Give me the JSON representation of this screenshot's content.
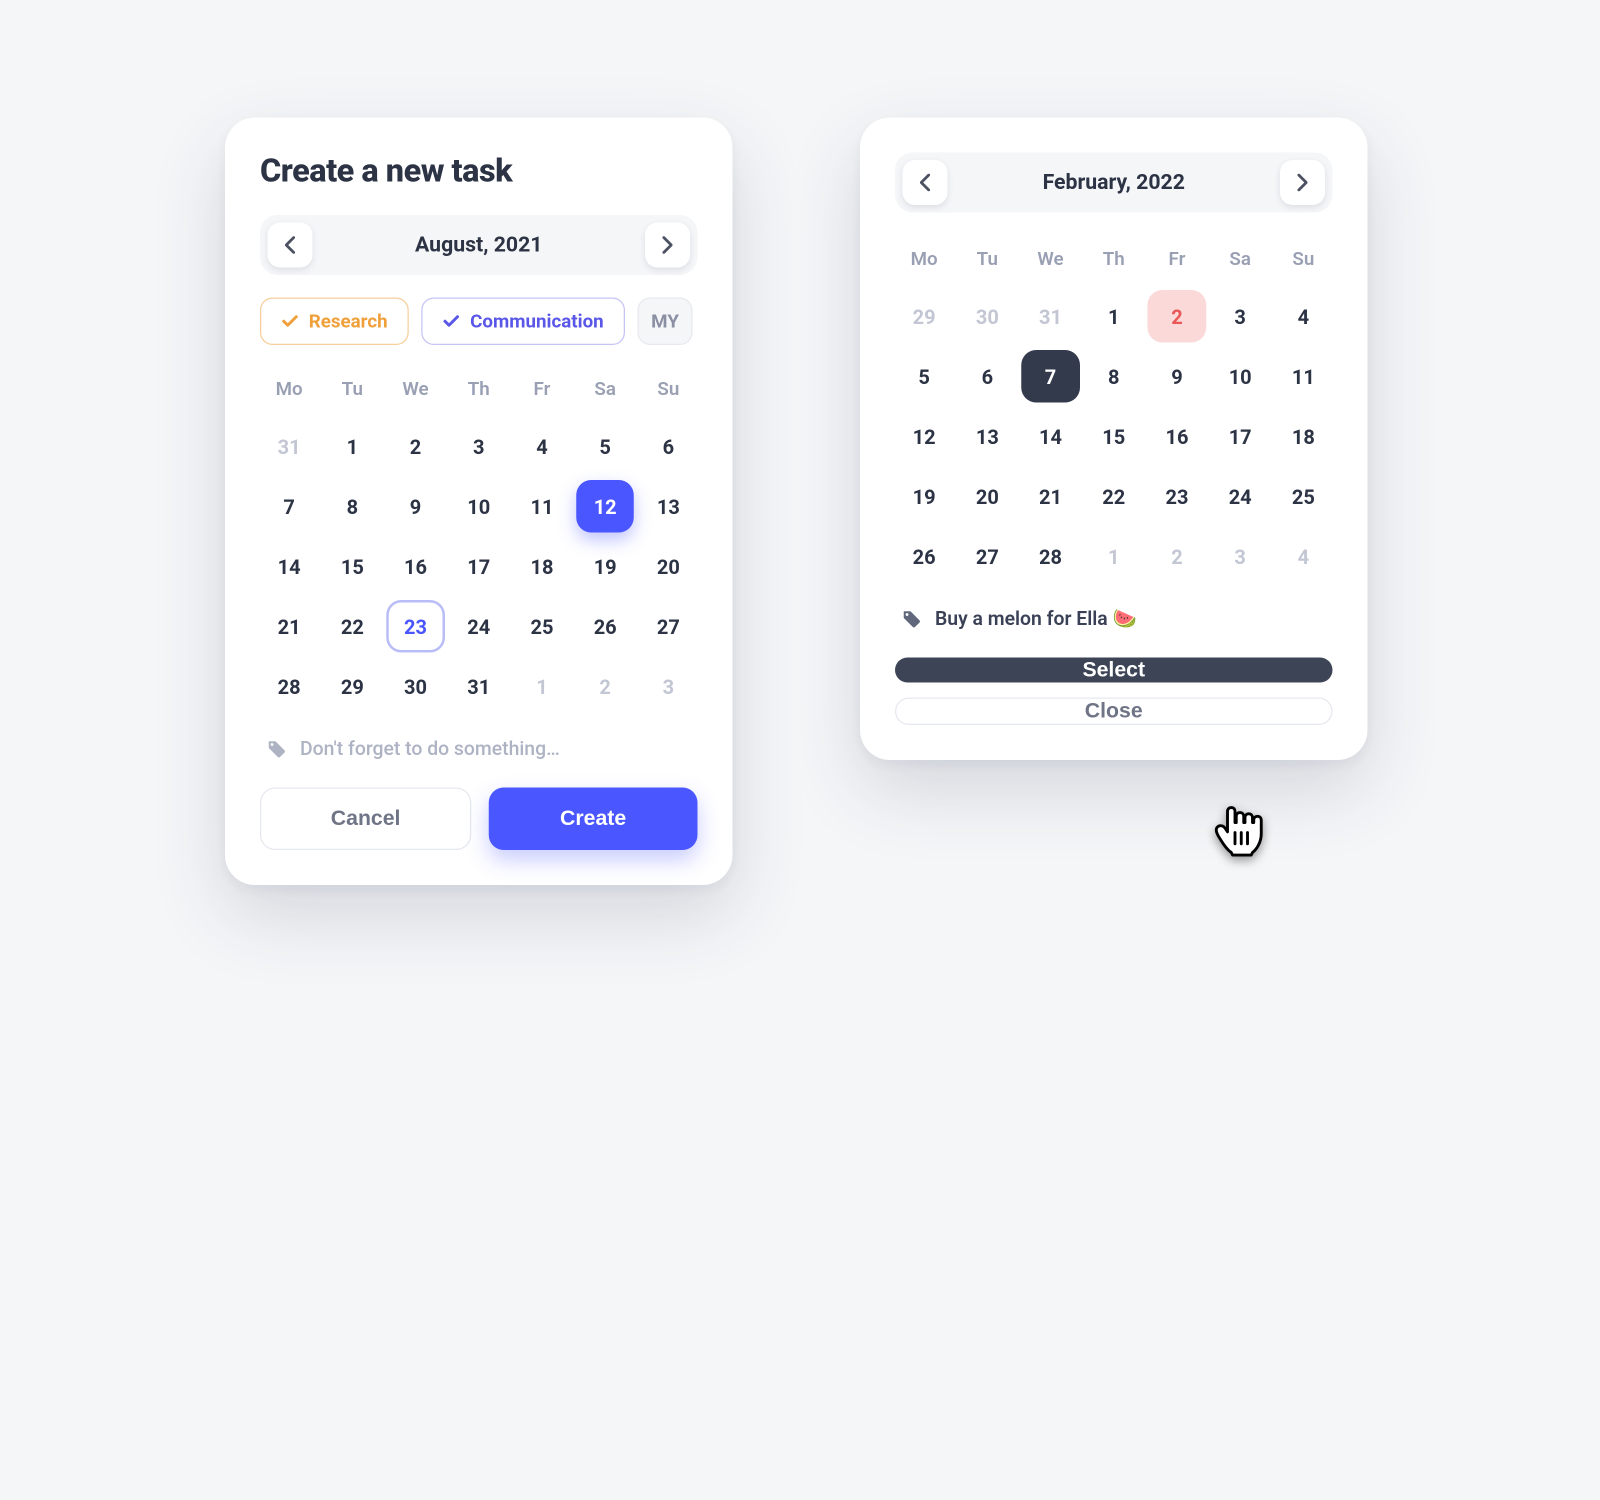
{
  "left": {
    "title": "Create a new task",
    "month": "August, 2021",
    "tags": {
      "research": "Research",
      "communication": "Communication",
      "partial": "MY"
    },
    "dow": [
      "Mo",
      "Tu",
      "We",
      "Th",
      "Fr",
      "Sa",
      "Su"
    ],
    "weeks": [
      [
        {
          "d": "31",
          "muted": true
        },
        {
          "d": "1"
        },
        {
          "d": "2"
        },
        {
          "d": "3"
        },
        {
          "d": "4"
        },
        {
          "d": "5"
        },
        {
          "d": "6"
        }
      ],
      [
        {
          "d": "7"
        },
        {
          "d": "8"
        },
        {
          "d": "9"
        },
        {
          "d": "10"
        },
        {
          "d": "11"
        },
        {
          "d": "12",
          "style": "sel-blue"
        },
        {
          "d": "13"
        }
      ],
      [
        {
          "d": "14"
        },
        {
          "d": "15"
        },
        {
          "d": "16"
        },
        {
          "d": "17"
        },
        {
          "d": "18"
        },
        {
          "d": "19"
        },
        {
          "d": "20"
        }
      ],
      [
        {
          "d": "21"
        },
        {
          "d": "22"
        },
        {
          "d": "23",
          "style": "outline-blue"
        },
        {
          "d": "24"
        },
        {
          "d": "25"
        },
        {
          "d": "26"
        },
        {
          "d": "27"
        }
      ],
      [
        {
          "d": "28"
        },
        {
          "d": "29"
        },
        {
          "d": "30"
        },
        {
          "d": "31"
        },
        {
          "d": "1",
          "muted": true
        },
        {
          "d": "2",
          "muted": true
        },
        {
          "d": "3",
          "muted": true
        }
      ]
    ],
    "note_placeholder": "Don't forget to do something…",
    "cancel": "Cancel",
    "create": "Create"
  },
  "right": {
    "month": "February, 2022",
    "dow": [
      "Mo",
      "Tu",
      "We",
      "Th",
      "Fr",
      "Sa",
      "Su"
    ],
    "weeks": [
      [
        {
          "d": "29",
          "muted": true
        },
        {
          "d": "30",
          "muted": true
        },
        {
          "d": "31",
          "muted": true
        },
        {
          "d": "1"
        },
        {
          "d": "2",
          "style": "highlight-red"
        },
        {
          "d": "3"
        },
        {
          "d": "4"
        }
      ],
      [
        {
          "d": "5"
        },
        {
          "d": "6"
        },
        {
          "d": "7",
          "style": "sel-dark"
        },
        {
          "d": "8"
        },
        {
          "d": "9"
        },
        {
          "d": "10"
        },
        {
          "d": "11"
        }
      ],
      [
        {
          "d": "12"
        },
        {
          "d": "13"
        },
        {
          "d": "14"
        },
        {
          "d": "15"
        },
        {
          "d": "16"
        },
        {
          "d": "17"
        },
        {
          "d": "18"
        }
      ],
      [
        {
          "d": "19"
        },
        {
          "d": "20"
        },
        {
          "d": "21"
        },
        {
          "d": "22"
        },
        {
          "d": "23"
        },
        {
          "d": "24"
        },
        {
          "d": "25"
        }
      ],
      [
        {
          "d": "26"
        },
        {
          "d": "27"
        },
        {
          "d": "28"
        },
        {
          "d": "1",
          "muted": true
        },
        {
          "d": "2",
          "muted": true
        },
        {
          "d": "3",
          "muted": true
        },
        {
          "d": "4",
          "muted": true
        }
      ]
    ],
    "note_text": "Buy a melon for Ella 🍉",
    "select": "Select",
    "close": "Close"
  }
}
